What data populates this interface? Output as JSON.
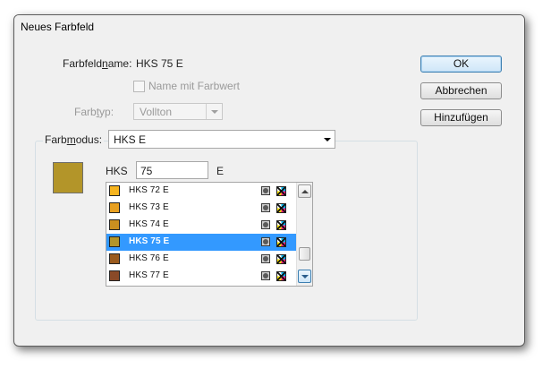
{
  "dialog": {
    "title": "Neues Farbfeld"
  },
  "swatch_name": {
    "label_pre": "Farbfeld",
    "label_mnemonic": "n",
    "label_post": "ame:",
    "value": "HKS 75 E"
  },
  "name_with_value": {
    "label": "Name mit Farbwert",
    "checked": false,
    "enabled": false
  },
  "color_type": {
    "label_pre": "Farb",
    "label_mnemonic": "t",
    "label_post": "yp:",
    "value": "Vollton",
    "enabled": false
  },
  "color_mode": {
    "label_pre": "Farb",
    "label_mnemonic": "m",
    "label_post": "odus:",
    "value": "HKS E"
  },
  "buttons": {
    "ok": "OK",
    "cancel": "Abbrechen",
    "add": "Hinzufügen"
  },
  "library": {
    "prefix": "HKS",
    "number": "75",
    "suffix": "E",
    "preview_color": "#b39529",
    "items": [
      {
        "name": "HKS 72 E",
        "color": "#f6b41e",
        "selected": false
      },
      {
        "name": "HKS 73 E",
        "color": "#e8a020",
        "selected": false
      },
      {
        "name": "HKS 74 E",
        "color": "#c99020",
        "selected": false
      },
      {
        "name": "HKS 75 E",
        "color": "#b39529",
        "selected": true
      },
      {
        "name": "HKS 76 E",
        "color": "#9a5a1e",
        "selected": false
      },
      {
        "name": "HKS 77 E",
        "color": "#8a4a28",
        "selected": false
      }
    ]
  },
  "icons": {
    "spot_icon": "spot-color-icon",
    "process_icon": "cmyk-icon",
    "scroll_up": "scroll-up-icon",
    "scroll_down": "scroll-down-icon"
  },
  "colors": {
    "selection": "#3399ff",
    "default_button_border": "#3c7fb1",
    "dialog_background": "#f0f0f0"
  }
}
